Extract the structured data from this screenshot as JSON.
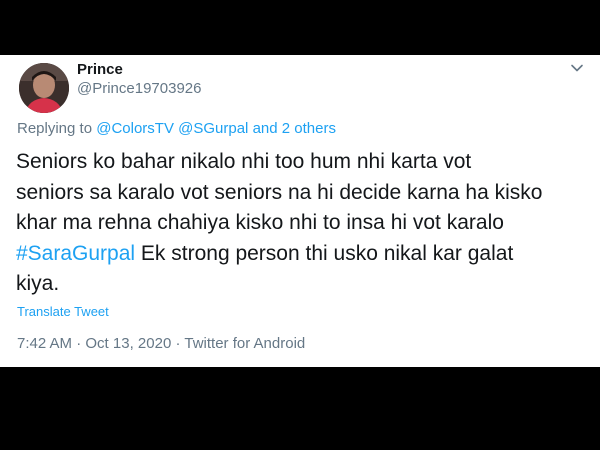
{
  "tweet": {
    "display_name": "Prince",
    "handle": "@Prince19703926",
    "reply": {
      "prefix": "Replying to",
      "user1": "@ColorsTV",
      "user2": "@SGurpal",
      "and": "and",
      "others": "2 others"
    },
    "text": {
      "line1": "Seniors ko bahar nikalo nhi too hum nhi karta vot",
      "line2": "seniors sa karalo vot seniors na hi decide karna ha kisko",
      "line3": "khar ma rehna chahiya kisko nhi to insa hi vot karalo",
      "hashtag": "#SaraGurpal",
      "line4_rest": " Ek strong person thi usko nikal kar galat",
      "line5": "kiya."
    },
    "translate_label": "Translate Tweet",
    "time": "7:42 AM",
    "separator1": " · ",
    "date": "Oct 13, 2020",
    "separator2": " · ",
    "source": "Twitter for Android"
  },
  "icons": {
    "caret": "chevron-down-icon"
  },
  "colors": {
    "link": "#1da1f2",
    "secondary": "#657786",
    "text": "#14171a"
  }
}
